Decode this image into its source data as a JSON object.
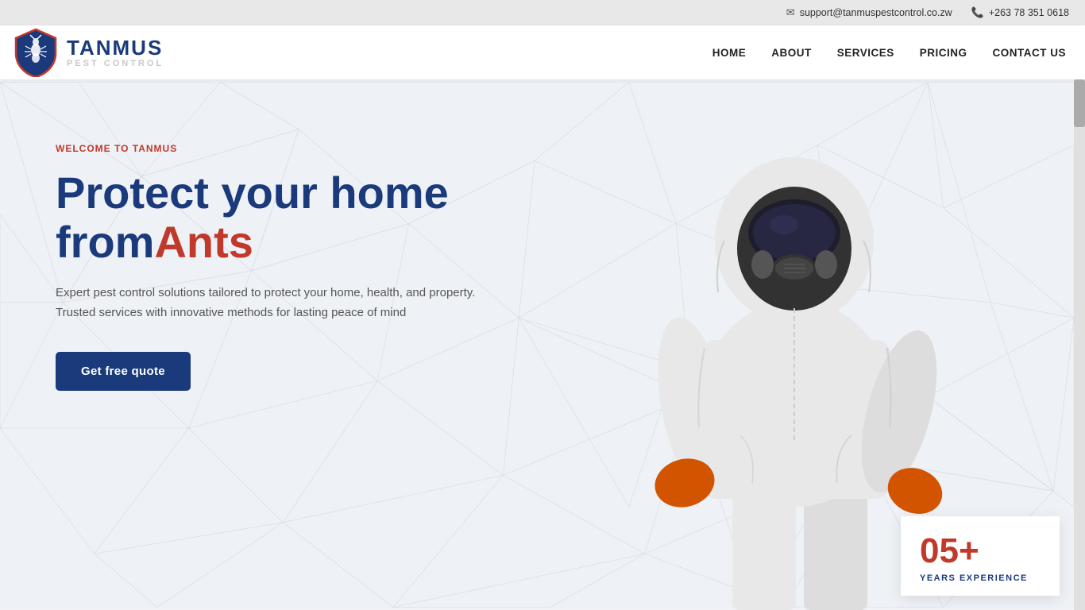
{
  "topbar": {
    "email": "support@tanmuspestcontrol.co.zw",
    "phone": "+263 78 351 0618"
  },
  "navbar": {
    "logo_name": "TANMUS",
    "logo_sub": "PEST CONTROL",
    "links": [
      {
        "label": "HOME",
        "id": "home"
      },
      {
        "label": "ABOUT",
        "id": "about"
      },
      {
        "label": "SERVICES",
        "id": "services"
      },
      {
        "label": "PRICING",
        "id": "pricing"
      },
      {
        "label": "CONTACT US",
        "id": "contact"
      }
    ]
  },
  "hero": {
    "welcome_label": "WELCOME TO TANMUS",
    "heading_line1": "Protect your home",
    "heading_line2_plain": "from",
    "heading_line2_highlight": "Ants",
    "description": "Expert pest control solutions tailored to protect your home, health, and property. Trusted services with innovative methods for lasting peace of mind",
    "cta_label": "Get free quote"
  },
  "stats": {
    "number": "05+",
    "label": "YEARS EXPERIENCE"
  },
  "colors": {
    "primary": "#1a3a7c",
    "accent": "#c0392b",
    "bg": "#f0f2f5"
  }
}
